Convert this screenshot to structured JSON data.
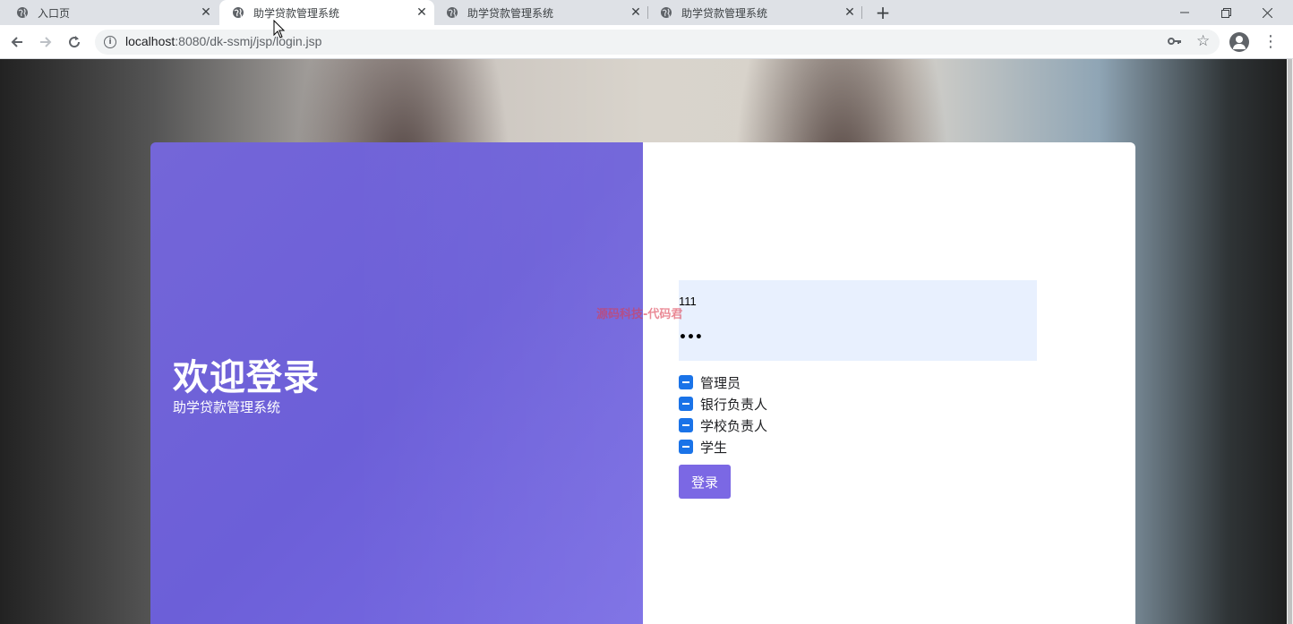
{
  "browser": {
    "tabs": [
      {
        "label": "入口页",
        "active": false
      },
      {
        "label": "助学贷款管理系统",
        "active": true
      },
      {
        "label": "助学贷款管理系统",
        "active": false
      },
      {
        "label": "助学贷款管理系统",
        "active": false
      }
    ],
    "new_tab": "+",
    "url_host": "localhost",
    "url_rest": ":8080/dk-ssmj/jsp/login.jsp"
  },
  "login": {
    "welcome": "欢迎登录",
    "subtitle": "助学贷款管理系统",
    "username_value": "111",
    "password_mask": "•••",
    "roles": [
      "管理员",
      "银行负责人",
      "学校负责人",
      "学生"
    ],
    "submit_label": "登录"
  },
  "watermark": "源码科技-代码君",
  "colors": {
    "accent": "#7b68e4",
    "checkbox": "#1a73e8",
    "autofill": "#e8f0fe"
  }
}
